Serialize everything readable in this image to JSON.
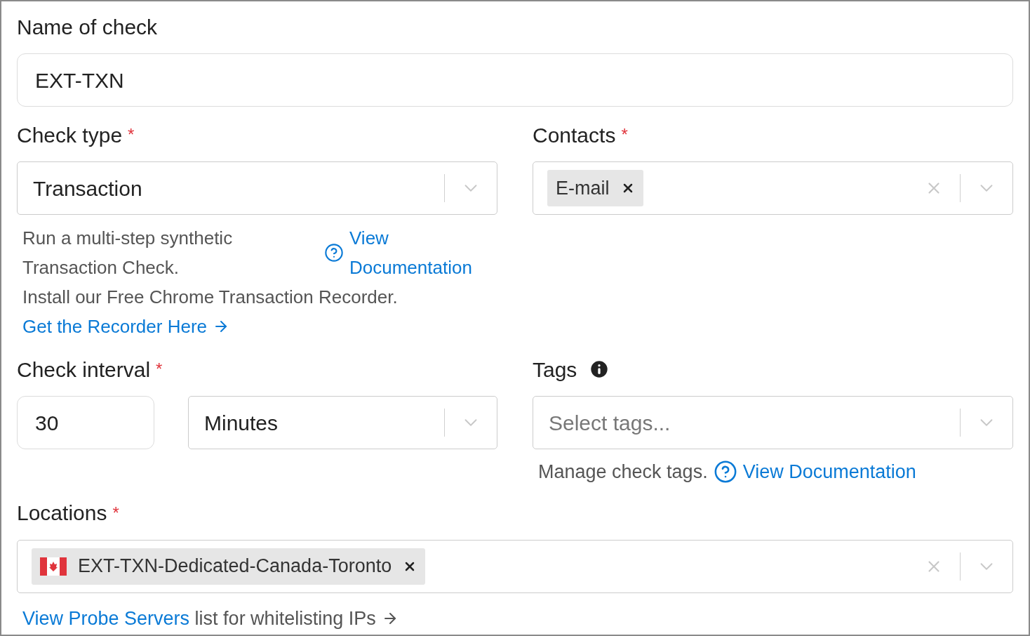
{
  "name_field": {
    "label": "Name of check",
    "value": "EXT-TXN"
  },
  "check_type": {
    "label": "Check type",
    "required_mark": "*",
    "value": "Transaction",
    "description": "Run a multi-step synthetic Transaction Check.",
    "doc_link": "View Documentation",
    "install_text": "Install our Free Chrome Transaction Recorder.",
    "recorder_link": "Get the Recorder Here"
  },
  "contacts": {
    "label": "Contacts",
    "required_mark": "*",
    "chips": [
      {
        "label": "E-mail"
      }
    ]
  },
  "check_interval": {
    "label": "Check interval",
    "required_mark": "*",
    "value": "30",
    "unit": "Minutes"
  },
  "tags": {
    "label": "Tags",
    "placeholder": "Select tags...",
    "help": "Manage check tags.",
    "doc_link": "View Documentation"
  },
  "locations": {
    "label": "Locations",
    "required_mark": "*",
    "chips": [
      {
        "label": "EXT-TXN-Dedicated-Canada-Toronto",
        "flag": true
      }
    ],
    "footer_link": "View Probe Servers",
    "footer_text": " list for whitelisting IPs"
  }
}
